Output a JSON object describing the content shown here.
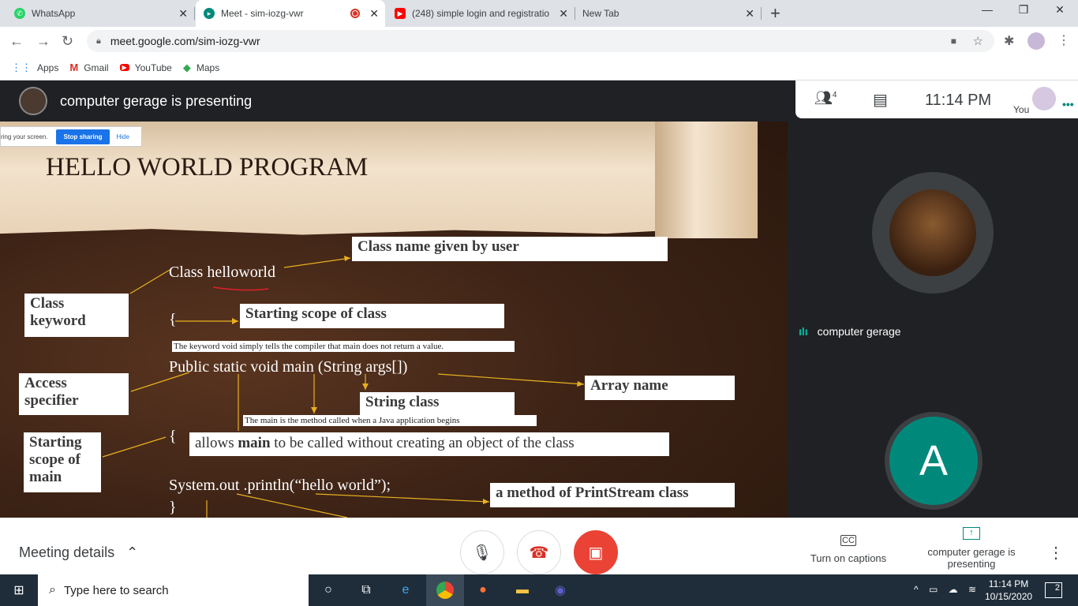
{
  "browser": {
    "tabs": [
      {
        "label": "WhatsApp",
        "icon": "whatsapp-icon"
      },
      {
        "label": "Meet - sim-iozg-vwr",
        "icon": "meet-icon",
        "active": true
      },
      {
        "label": "(248) simple login and registratio",
        "icon": "youtube-icon"
      },
      {
        "label": "New Tab",
        "icon": ""
      }
    ],
    "new_tab": "+",
    "url": "meet.google.com/sim-iozg-vwr",
    "bookmarks": [
      {
        "label": "Apps",
        "icon": "apps-grid-icon"
      },
      {
        "label": "Gmail",
        "icon": "gmail-icon"
      },
      {
        "label": "YouTube",
        "icon": "youtube-icon"
      },
      {
        "label": "Maps",
        "icon": "maps-icon"
      }
    ]
  },
  "meet": {
    "presenting_text": "computer gerage is presenting",
    "participants_count": "4",
    "time": "11:14  PM",
    "you_label": "You",
    "participant_name": "computer gerage",
    "avatar_letter": "A",
    "meeting_details": "Meeting details",
    "captions_label": "Turn on captions",
    "presenting_label": "computer gerage is presenting",
    "accent": "#1a73e8",
    "end_red": "#ea4335",
    "avatar_teal": "#00897b"
  },
  "share_bar": {
    "text": "ring your screen.",
    "stop": "Stop sharing",
    "hide": "Hide"
  },
  "slide": {
    "title": "HELLO WORLD PROGRAM",
    "code": {
      "class_line": "Class helloworld",
      "brace1": "{",
      "main_line": "Public static void main (String args[])",
      "brace2": "{",
      "print_line": "System.out .println(“hello world”);",
      "brace3": "}"
    },
    "labels": {
      "class_name": "Class name given by user",
      "class_keyword": "Class keyword",
      "scope_class": "Starting scope of class",
      "access": "Access specifier",
      "string_class": "String class",
      "array_name": "Array name",
      "scope_main": "Starting scope of main",
      "method": "a method of PrintStream class"
    },
    "notes": {
      "void_note": "The keyword void simply tells the compiler that main does not return a value.",
      "main_note": "The main is the method called when a Java application begins",
      "static_prefix": "allows ",
      "static_bold": "main",
      "static_suffix": " to be called without creating an object of the class"
    }
  },
  "taskbar": {
    "search_placeholder": "Type here to search",
    "time": "11:14 PM",
    "date": "10/15/2020",
    "notifications": "2"
  }
}
